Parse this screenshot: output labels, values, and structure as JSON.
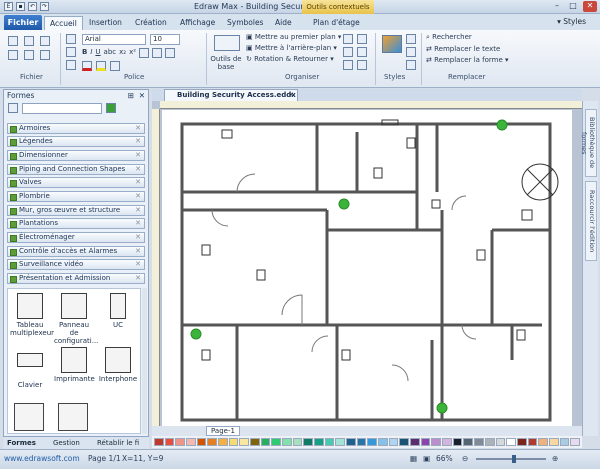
{
  "titlebar": {
    "title": "Edraw Max - Building Security Access.eddx",
    "contextual": "Outils contextuels",
    "minimize": "–",
    "maximize": "□",
    "close": "✕"
  },
  "tabs": {
    "file": "Fichier",
    "items": [
      "Accueil",
      "Insertion",
      "Création",
      "Affichage",
      "Symboles",
      "Aide",
      "Plan d'étage"
    ],
    "styles": "Styles"
  },
  "ribbon": {
    "fichier_label": "Fichier",
    "police_label": "Police",
    "font_name": "Arial",
    "font_size": "10",
    "basic_tools": "Outils de base",
    "organiser_label": "Organiser",
    "bring_front": "Mettre au premier plan",
    "send_back": "Mettre à l'arrière-plan",
    "rotate": "Rotation & Retourner",
    "styles_label": "Styles",
    "search": "Rechercher",
    "replace_text": "Remplacer le texte",
    "replace_shape": "Remplacer la forme",
    "replace_label": "Remplacer"
  },
  "shapes_panel": {
    "title": "Formes",
    "pin": "⊞",
    "close": "✕",
    "libraries": [
      "Armoires",
      "Légendes",
      "Dimensionner",
      "Piping and Connection Shapes",
      "Valves",
      "Plombrie",
      "Mur, gros œuvre et structure",
      "Plantations",
      "Électroménager",
      "Contrôle d'accès et Alarmes",
      "Surveillance vidéo",
      "Présentation et Admission"
    ],
    "shapes": [
      {
        "label": "Tableau multiplexeur"
      },
      {
        "label": "Panneau de configurati..."
      },
      {
        "label": "UC"
      },
      {
        "label": "Clavier"
      },
      {
        "label": "Imprimante"
      },
      {
        "label": "Interphone"
      }
    ],
    "bottom_tabs": [
      "Formes",
      "Gestion",
      "Rétablir le fi"
    ]
  },
  "document": {
    "tab_title": "Building Security Access.eddx",
    "page_tab": "Page-1"
  },
  "side_tabs": [
    "Bibliothèque de formes",
    "Raccourcir l'édition"
  ],
  "palette": [
    "#c0392b",
    "#e74c3c",
    "#f1948a",
    "#f5b7b1",
    "#d35400",
    "#e67e22",
    "#f5b041",
    "#f7dc6f",
    "#f9e79f",
    "#7d6608",
    "#27ae60",
    "#2ecc71",
    "#82e0aa",
    "#a9dfbf",
    "#117a65",
    "#16a085",
    "#48c9b0",
    "#a3e4d7",
    "#1f618d",
    "#2874a6",
    "#3498db",
    "#85c1e9",
    "#aed6f1",
    "#1a5276",
    "#5b2c6f",
    "#8e44ad",
    "#bb8fce",
    "#d2b4de",
    "#17202a",
    "#566573",
    "#808b96",
    "#abb2b9",
    "#d5d8dc",
    "#ffffff",
    "#7b241c",
    "#b03a2e",
    "#f0b27a",
    "#fad7a0",
    "#a9cce3",
    "#e8daef"
  ],
  "status": {
    "website": "www.edrawsoft.com",
    "page": "Page 1/1",
    "coords": "X=11, Y=9",
    "zoom": "66%"
  }
}
